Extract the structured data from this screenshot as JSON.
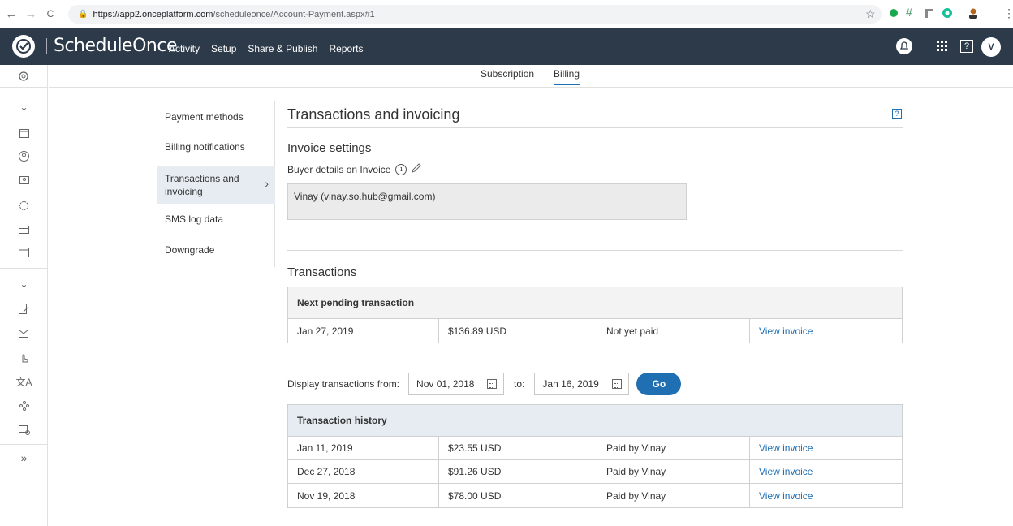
{
  "browser": {
    "back": "←",
    "forward": "→",
    "reload": "C",
    "url_host": "https://app2.onceplatform.com",
    "url_path": "/scheduleonce/Account-Payment.aspx#1"
  },
  "header": {
    "brand": "ScheduleOnce",
    "nav": [
      "Activity",
      "Setup",
      "Share & Publish",
      "Reports"
    ],
    "avatar_initial": "V",
    "help": "?"
  },
  "subtabs": {
    "subscription": "Subscription",
    "billing": "Billing"
  },
  "menu": {
    "items": [
      "Payment methods",
      "Billing notifications",
      "Transactions and invoicing",
      "SMS log data",
      "Downgrade"
    ],
    "active_line1": "Transactions and",
    "active_line2": "invoicing"
  },
  "content": {
    "title": "Transactions and invoicing",
    "help": "?",
    "invoice_settings_title": "Invoice settings",
    "buyer_label": "Buyer details on Invoice",
    "buyer_value": "Vinay (vinay.so.hub@gmail.com)",
    "transactions_title": "Transactions",
    "pending": {
      "header": "Next pending transaction",
      "row": [
        "Jan 27, 2019",
        "$136.89 USD",
        "Not yet paid",
        "View invoice"
      ]
    },
    "filter": {
      "label": "Display transactions from:",
      "from": "Nov 01, 2018",
      "to_label": "to:",
      "to": "Jan 16, 2019",
      "go": "Go"
    },
    "history": {
      "header": "Transaction history",
      "rows": [
        [
          "Jan 11, 2019",
          "$23.55 USD",
          "Paid by Vinay",
          "View invoice"
        ],
        [
          "Dec 27, 2018",
          "$91.26 USD",
          "Paid by Vinay",
          "View invoice"
        ],
        [
          "Nov 19, 2018",
          "$78.00 USD",
          "Paid by Vinay",
          "View invoice"
        ]
      ]
    }
  },
  "colors": {
    "header_bg": "#2d3a4a",
    "accent": "#1f6fb2",
    "active_menu_bg": "#e6ecf2",
    "history_header_bg": "#e6ecf2"
  }
}
